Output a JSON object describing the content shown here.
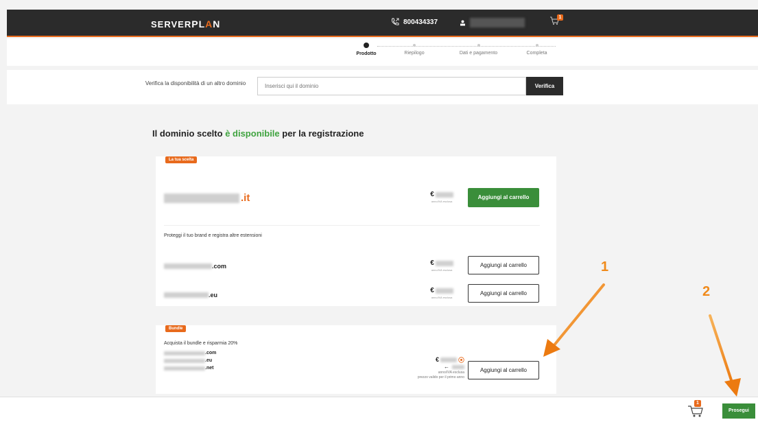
{
  "header": {
    "logo_server": "SERVER",
    "logo_plan_p": "PL",
    "logo_plan_a": "A",
    "logo_plan_n": "N",
    "phone": "800434337",
    "cart_count": "1"
  },
  "steps": [
    {
      "label": "Prodotto"
    },
    {
      "label": "Riepilogo"
    },
    {
      "label": "Dati e pagamento"
    },
    {
      "label": "Completa"
    }
  ],
  "verify": {
    "label": "Verifica la disponibilità di un altro dominio",
    "placeholder": "Inserisci qui il dominio",
    "button": "Verifica"
  },
  "heading": {
    "part1": "Il dominio scelto ",
    "part2": "è disponibile",
    "part3": " per la registrazione"
  },
  "choice": {
    "tag": "La tua scelta",
    "tld": ".it",
    "euro": "€",
    "price_note": "anno/IVA esclusa",
    "add_button": "Aggiungi al carrello"
  },
  "protect_text": "Proteggi il tuo brand e registra altre estensioni",
  "extensions": [
    {
      "tld": ".com",
      "euro": "€",
      "price_note": "anno/IVA esclusa",
      "add_button": "Aggiungi al carrello"
    },
    {
      "tld": ".eu",
      "euro": "€",
      "price_note": "anno/IVA esclusa",
      "add_button": "Aggiungi al carrello"
    }
  ],
  "bundle": {
    "tag": "Bundle",
    "text": "Acquista il bundle e risparmia 20%",
    "tlds": [
      ".com",
      ".eu",
      ".net"
    ],
    "euro": "€",
    "arrow": "←",
    "price_note": "anno/IVA esclusa",
    "valid_note": "prezzo valido per il primo anno",
    "add_button": "Aggiungi al carrello"
  },
  "annotations": {
    "one": "1",
    "two": "2"
  },
  "footer": {
    "proceed": "Prosegui",
    "cart_count": "1"
  },
  "colors": {
    "brand_orange": "#e86a1c",
    "green": "#3a8e3a",
    "dark": "#2b2b2b",
    "arrow_orange": "#f08a1a"
  }
}
